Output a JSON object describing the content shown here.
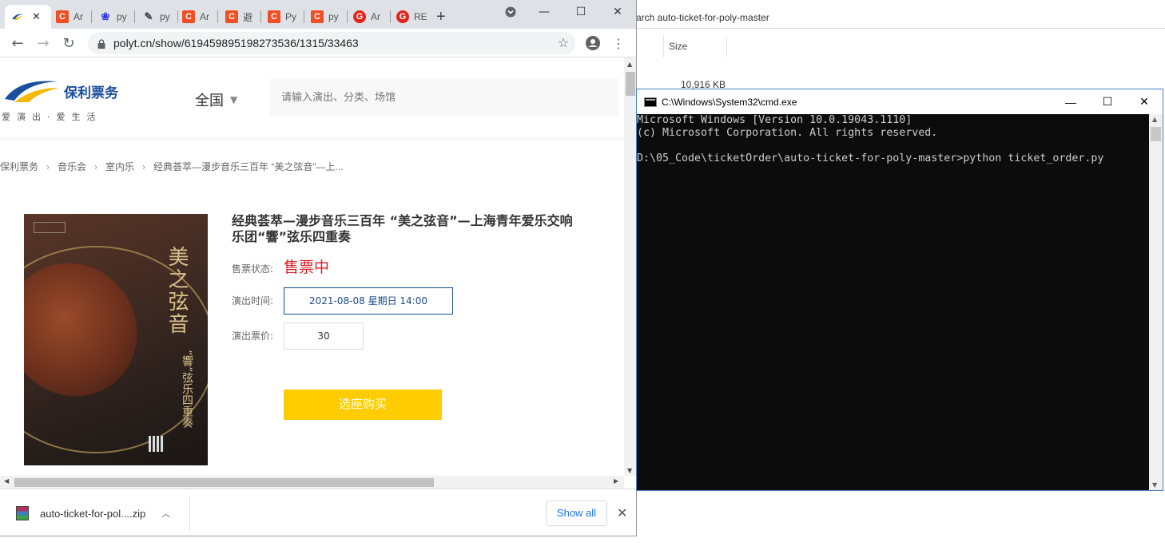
{
  "explorer": {
    "address_text": "arch auto-ticket-for-poly-master",
    "column_header": "Size",
    "file_size": "10,916 KB"
  },
  "browser": {
    "tabs": [
      {
        "label": "",
        "favicon": "poly-logo-icon"
      },
      {
        "label": "Ar",
        "favicon": "csdn-icon"
      },
      {
        "label": "py",
        "favicon": "baidu-paw-icon"
      },
      {
        "label": "py",
        "favicon": "pen-icon"
      },
      {
        "label": "Ar",
        "favicon": "csdn-icon"
      },
      {
        "label": "避",
        "favicon": "csdn-icon"
      },
      {
        "label": "Py",
        "favicon": "csdn-icon"
      },
      {
        "label": "py",
        "favicon": "csdn-icon"
      },
      {
        "label": "Ar",
        "favicon": "g-red-icon"
      },
      {
        "label": "RE",
        "favicon": "g-red-icon"
      }
    ],
    "new_tab": "+",
    "url": "polyt.cn/show/619459895198273536/1315/33463"
  },
  "site": {
    "logo_name": "保利票务",
    "logo_slogan": "爱演出·爱生活",
    "city": "全国",
    "search_placeholder": "请输入演出、分类、场馆",
    "breadcrumb": [
      "保利票务",
      "音乐会",
      "室内乐",
      "经典荟萃—漫步音乐三百年 “美之弦音”—上..."
    ],
    "poster_title_vertical": "美之弦音",
    "poster_sub_vertical": "“響”弦乐四重奏",
    "show_title": "经典荟萃—漫步音乐三百年 “美之弦音”—上海青年爱乐交响乐团“響”弦乐四重奏",
    "status_label": "售票状态:",
    "status_value": "售票中",
    "time_label": "演出时间:",
    "time_value": "2021-08-08 星期日 14:00",
    "price_label": "演出票价:",
    "price_value": "30",
    "buy_button": "选座购买"
  },
  "download": {
    "file_name": "auto-ticket-for-pol....zip",
    "show_all": "Show all"
  },
  "cmd": {
    "title": "C:\\Windows\\System32\\cmd.exe",
    "lines": [
      "Microsoft Windows [Version 10.0.19043.1110]",
      "(c) Microsoft Corporation. All rights reserved.",
      "",
      "D:\\05_Code\\ticketOrder\\auto-ticket-for-poly-master>python ticket_order.py"
    ]
  },
  "colors": {
    "status_red": "#d8202a",
    "buy_yellow": "#ffcc00",
    "brand_blue": "#1a4fa0"
  }
}
